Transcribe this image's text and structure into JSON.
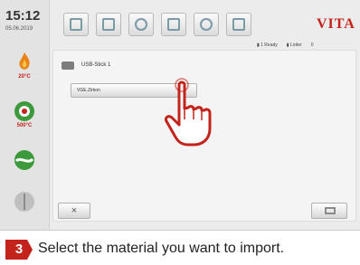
{
  "statusbar": {
    "time": "15:12",
    "date": "05.06.2019"
  },
  "sidebar": {
    "temp1": "20°C",
    "temp2": "500°C"
  },
  "toolbar": {
    "buttons": [
      "program-icon",
      "import-icon",
      "settings-icon",
      "display-icon",
      "camera-icon",
      "info-icon"
    ]
  },
  "header": {
    "brand": "VITA",
    "stat1": "▮ 1 Ready",
    "stat2": "▮ Lotter",
    "stat3": "0"
  },
  "usb": {
    "title": "USB-Stick 1",
    "file": "VGE.Zirkon"
  },
  "footer": {
    "cancel_label": "×"
  },
  "caption": {
    "step_number": "3",
    "text": "Select the material you want to import."
  },
  "colors": {
    "accent": "#c4231b",
    "flame": "#e8841a",
    "green": "#3c9a3c"
  }
}
